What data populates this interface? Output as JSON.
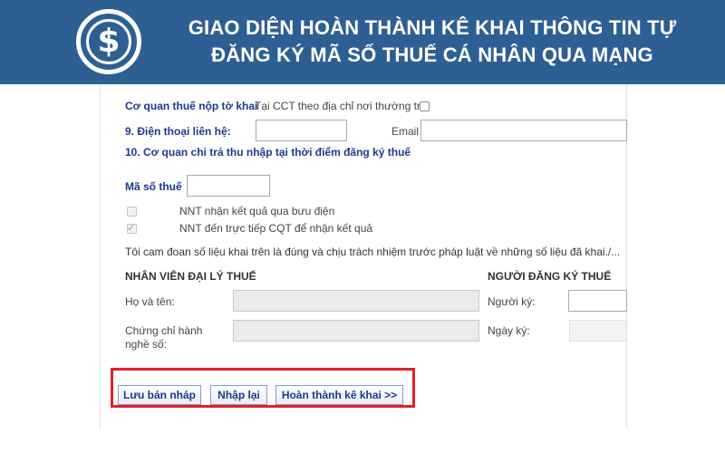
{
  "banner": {
    "title_line1": "GIAO DIỆN HOÀN THÀNH KÊ KHAI THÔNG TIN TỰ",
    "title_line2": "ĐĂNG KÝ MÃ SỐ THUẾ CÁ NHÂN QUA MẠNG",
    "logo_glyph": "$",
    "logo_icon": "dollar-coin-icon",
    "color": "#2e5f92"
  },
  "form": {
    "tax_office_label": "Cơ quan thuế nộp tờ khai",
    "tax_office_option": "Tại CCT theo địa chỉ nơi thường trú",
    "phone_label": "9. Điện thoại liên hệ:",
    "phone_value": "",
    "email_label": "Email",
    "email_value": "",
    "income_payer_label": "10. Cơ quan chi trả thu nhập tại thời điểm đăng ký thuế",
    "tax_code_label": "Mã số thuế",
    "tax_code_value": "",
    "option_post": "NNT nhận kết quả qua bưu điện",
    "option_direct": "NNT đến trực tiếp CQT để nhận kết quả",
    "commitment": "Tôi cam đoan số liệu khai trên là đúng và chịu trách nhiệm trước pháp luật về những số liệu đã khai./...",
    "agent_heading": "NHÂN VIÊN ĐẠI LÝ THUẾ",
    "registrant_heading": "NGƯỜI ĐĂNG KÝ THUẾ",
    "full_name_label": "Họ và tên:",
    "certificate_label_1": "Chứng chỉ hành",
    "certificate_label_2": "nghề số:",
    "signer_label": "Người ký:",
    "sign_date_label": "Ngày ký:"
  },
  "buttons": {
    "save_draft": "Lưu bản nháp",
    "reset": "Nhập lại",
    "complete": "Hoàn thành kê khai >>"
  },
  "highlight_color": "#e0202a"
}
